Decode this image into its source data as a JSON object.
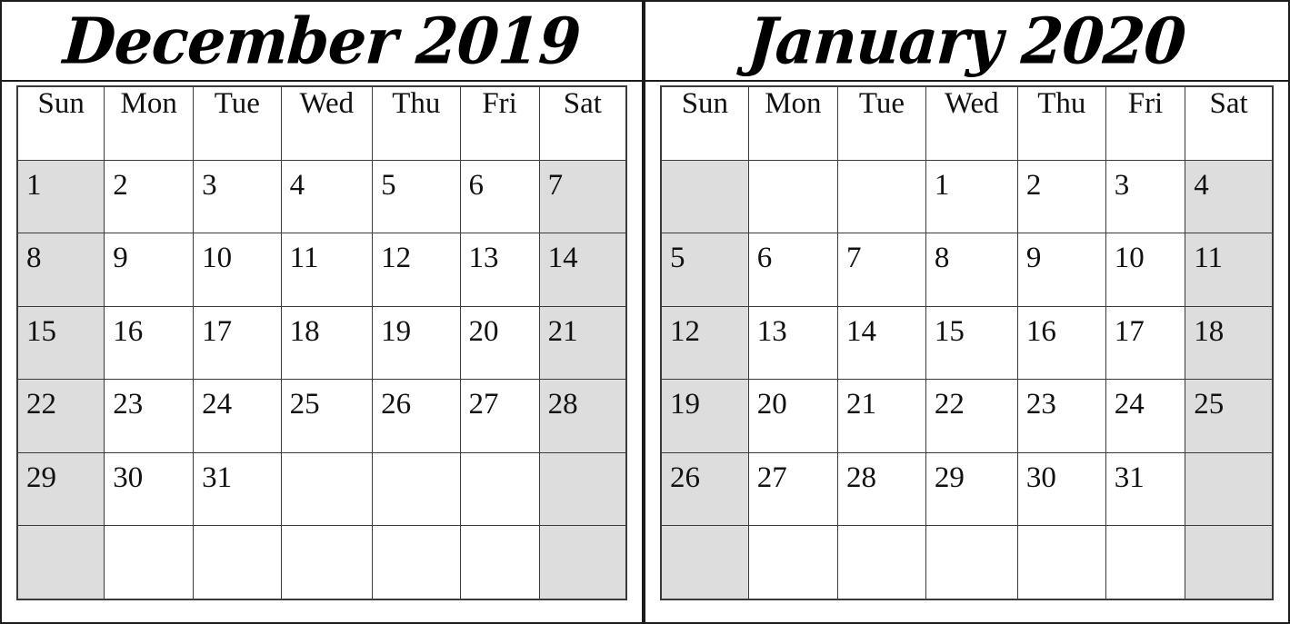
{
  "sheet": {
    "colors": {
      "weekend_shade": "#dddddd",
      "header_shade": "#dddddd",
      "grid_line": "#3a3a3a",
      "panel_border": "#1c1c1c",
      "text": "#111111",
      "page_background": "#ffffff"
    }
  },
  "months": [
    {
      "key": "december-2019",
      "title": "December 2019",
      "month_name": "December",
      "year": "2019",
      "weekday_headers": [
        "Sun",
        "Mon",
        "Tue",
        "Wed",
        "Thu",
        "Fri",
        "Sat"
      ],
      "weeks": [
        [
          "1",
          "2",
          "3",
          "4",
          "5",
          "6",
          "7"
        ],
        [
          "8",
          "9",
          "10",
          "11",
          "12",
          "13",
          "14"
        ],
        [
          "15",
          "16",
          "17",
          "18",
          "19",
          "20",
          "21"
        ],
        [
          "22",
          "23",
          "24",
          "25",
          "26",
          "27",
          "28"
        ],
        [
          "29",
          "30",
          "31",
          "",
          "",
          "",
          ""
        ],
        [
          "",
          "",
          "",
          "",
          "",
          "",
          ""
        ]
      ]
    },
    {
      "key": "january-2020",
      "title": "January 2020",
      "month_name": "January",
      "year": "2020",
      "weekday_headers": [
        "Sun",
        "Mon",
        "Tue",
        "Wed",
        "Thu",
        "Fri",
        "Sat"
      ],
      "weeks": [
        [
          "",
          "",
          "",
          "1",
          "2",
          "3",
          "4"
        ],
        [
          "5",
          "6",
          "7",
          "8",
          "9",
          "10",
          "11"
        ],
        [
          "12",
          "13",
          "14",
          "15",
          "16",
          "17",
          "18"
        ],
        [
          "19",
          "20",
          "21",
          "22",
          "23",
          "24",
          "25"
        ],
        [
          "26",
          "27",
          "28",
          "29",
          "30",
          "31",
          ""
        ],
        [
          "",
          "",
          "",
          "",
          "",
          "",
          ""
        ]
      ]
    }
  ]
}
